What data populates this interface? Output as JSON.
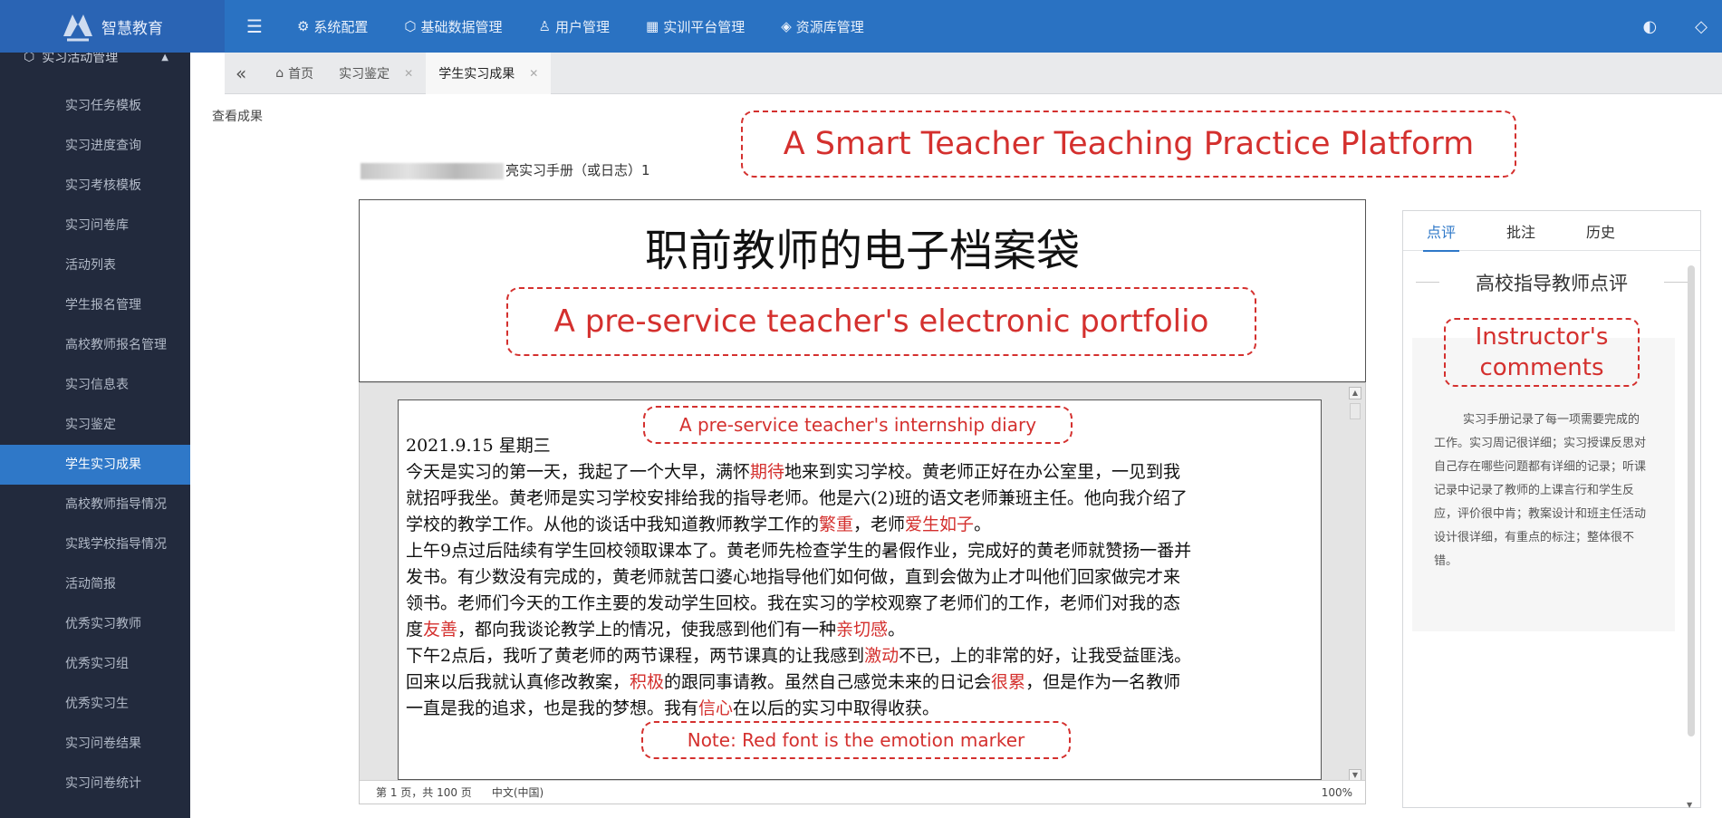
{
  "app": {
    "logo_text": "智慧教育"
  },
  "topnav": {
    "items": [
      {
        "label": "系统配置",
        "icon": "gear-icon"
      },
      {
        "label": "基础数据管理",
        "icon": "cube-icon"
      },
      {
        "label": "用户管理",
        "icon": "user-icon"
      },
      {
        "label": "实训平台管理",
        "icon": "grid-icon"
      },
      {
        "label": "资源库管理",
        "icon": "layers-icon"
      }
    ],
    "right_icons": [
      "palette-icon",
      "tag-icon"
    ]
  },
  "sidebar": {
    "group_label": "实习活动管理",
    "items": [
      {
        "label": "实习任务模板"
      },
      {
        "label": "实习进度查询"
      },
      {
        "label": "实习考核模板"
      },
      {
        "label": "实习问卷库"
      },
      {
        "label": "活动列表"
      },
      {
        "label": "学生报名管理"
      },
      {
        "label": "高校教师报名管理"
      },
      {
        "label": "实习信息表"
      },
      {
        "label": "实习鉴定"
      },
      {
        "label": "学生实习成果",
        "active": true
      },
      {
        "label": "高校教师指导情况"
      },
      {
        "label": "实践学校指导情况"
      },
      {
        "label": "活动简报"
      },
      {
        "label": "优秀实习教师"
      },
      {
        "label": "优秀实习组"
      },
      {
        "label": "优秀实习生"
      },
      {
        "label": "实习问卷结果"
      },
      {
        "label": "实习问卷统计"
      }
    ]
  },
  "tabs": [
    {
      "label": "首页",
      "closable": false
    },
    {
      "label": "实习鉴定",
      "closable": true
    },
    {
      "label": "学生实习成果",
      "closable": true,
      "active": true
    }
  ],
  "breadcrumb": "查看成果",
  "annotations": {
    "platform": "A Smart Teacher Teaching Practice Platform",
    "portfolio": "A pre-service teacher's electronic portfolio",
    "diary": "A pre-service teacher's internship diary",
    "note": "Note: Red font is the emotion marker",
    "instructor": "Instructor's comments"
  },
  "document": {
    "caption_suffix": "亮实习手册（或日志）1",
    "title": "职前教师的电子档案袋",
    "diary_lines": [
      [
        {
          "t": "2021.9.15 星期三"
        }
      ],
      [
        {
          "t": "今天是实习的第一天，我起了一个大早，满怀"
        },
        {
          "t": "期待",
          "em": true
        },
        {
          "t": "地来到实习学校。黄老师正好在办公室里，一见到我"
        }
      ],
      [
        {
          "t": "就招呼我坐。黄老师是实习学校安排给我的指导老师。他是六(2)班的语文老师兼班主任。他向我介绍了"
        }
      ],
      [
        {
          "t": "学校的教学工作。从他的谈话中我知道教师教学工作的"
        },
        {
          "t": "繁重",
          "em": true
        },
        {
          "t": "，老师"
        },
        {
          "t": "爱生如子",
          "em": true
        },
        {
          "t": "。"
        }
      ],
      [
        {
          "t": "上午9点过后陆续有学生回校领取课本了。黄老师先检查学生的暑假作业，完成好的黄老师就赞扬一番并"
        }
      ],
      [
        {
          "t": "发书。有少数没有完成的，黄老师就苦口婆心地指导他们如何做，直到会做为止才叫他们回家做完才来"
        }
      ],
      [
        {
          "t": "领书。老师们今天的工作主要的发动学生回校。我在实习的学校观察了老师们的工作，老师们对我的态"
        }
      ],
      [
        {
          "t": "度"
        },
        {
          "t": "友善",
          "em": true
        },
        {
          "t": "，都向我谈论教学上的情况，使我感到他们有一种"
        },
        {
          "t": "亲切感",
          "em": true
        },
        {
          "t": "。"
        }
      ],
      [
        {
          "t": "下午2点后，我听了黄老师的两节课程，两节课真的让我感到"
        },
        {
          "t": "激动",
          "em": true
        },
        {
          "t": "不已，上的非常的好，让我受益匪浅。"
        }
      ],
      [
        {
          "t": "回来以后我就认真修改教案，"
        },
        {
          "t": "积极",
          "em": true
        },
        {
          "t": "的跟同事请教。虽然自己感觉未来的日记会"
        },
        {
          "t": "很累",
          "em": true
        },
        {
          "t": "，但是作为一名教师"
        }
      ],
      [
        {
          "t": "一直是我的追求，也是我的梦想。我有"
        },
        {
          "t": "信心",
          "em": true
        },
        {
          "t": "在以后的实习中取得收获。"
        }
      ]
    ],
    "status": {
      "pages": "第 1 页，共 100 页",
      "language": "中文(中国)",
      "zoom": "100%"
    }
  },
  "review_panel": {
    "tabs": [
      {
        "label": "点评",
        "active": true
      },
      {
        "label": "批注"
      },
      {
        "label": "历史"
      }
    ],
    "section_title": "高校指导教师点评",
    "comment": "实习手册记录了每一项需要完成的工作。实习周记很详细；实习授课反思对自己存在哪些问题都有详细的记录；听课记录中记录了教师的上课言行和学生反应，评价很中肯；教案设计和班主任活动设计很详细，有重点的标注；整体很不错。"
  },
  "colors": {
    "accent": "#2f78c8",
    "topbar": "#2a72c2",
    "sidebar": "#222a3d",
    "emotion_marker": "#d4302e"
  }
}
